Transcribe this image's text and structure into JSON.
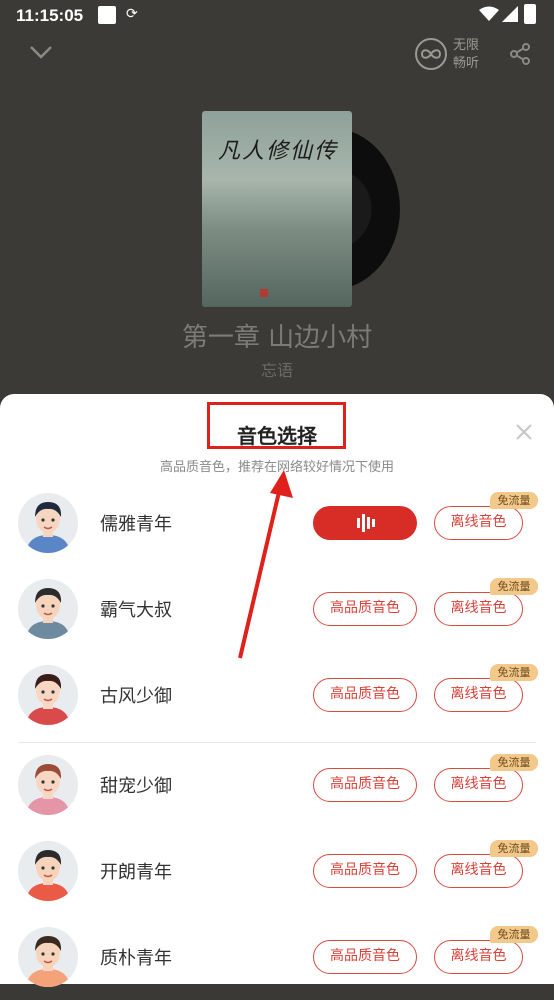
{
  "status_bar": {
    "time": "11:15:05"
  },
  "header": {
    "unlimited_line1": "无限",
    "unlimited_line2": "畅听"
  },
  "player": {
    "cover_title": "凡人修仙传",
    "chapter_title": "第一章 山边小村",
    "author": "忘语"
  },
  "sheet": {
    "title": "音色选择",
    "subtitle": "高品质音色，推荐在网络较好情况下使用",
    "hq_label": "高品质音色",
    "offline_label": "离线音色",
    "badge_label": "免流量",
    "voices": [
      {
        "name": "儒雅青年",
        "selected": true
      },
      {
        "name": "霸气大叔",
        "selected": false
      },
      {
        "name": "古风少御",
        "selected": false
      },
      {
        "name": "甜宠少御",
        "selected": false
      },
      {
        "name": "开朗青年",
        "selected": false
      },
      {
        "name": "质朴青年",
        "selected": false
      }
    ]
  },
  "colors": {
    "accent": "#d82c26",
    "badge": "#f3c98b",
    "annotation": "#e0201b"
  },
  "icons": [
    "chevron-down-icon",
    "infinity-icon",
    "share-icon",
    "close-icon",
    "playing-wave-icon"
  ]
}
